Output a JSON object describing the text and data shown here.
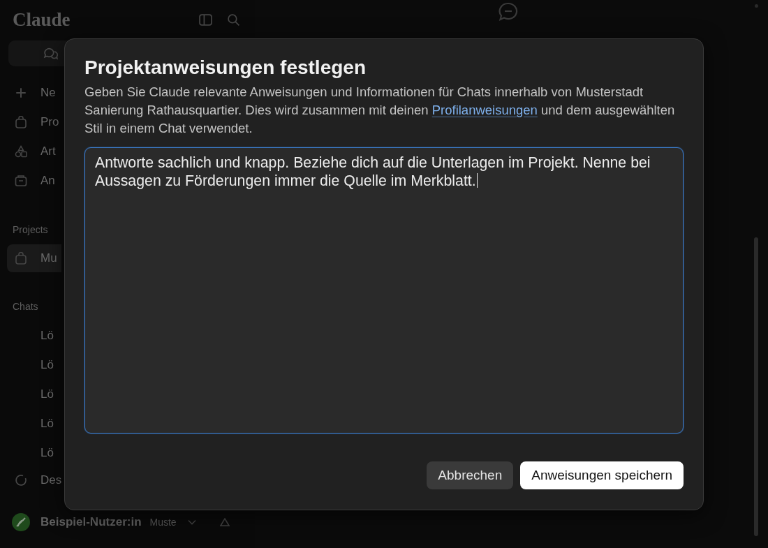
{
  "sidebar": {
    "logo": "Claude",
    "nav_items": [
      {
        "label": "Ne",
        "kind": "plus"
      },
      {
        "label": "Pro",
        "kind": "bag"
      },
      {
        "label": "Art",
        "kind": "shapes"
      },
      {
        "label": "An",
        "kind": "box"
      }
    ],
    "sections": [
      {
        "heading": "Projects",
        "kind": "projects",
        "items": [
          {
            "label": "Mu",
            "selected": true
          }
        ]
      },
      {
        "heading": "Chats",
        "kind": "chats",
        "items": [
          {
            "label": "Lö",
            "selected": false
          },
          {
            "label": "Lö",
            "selected": false
          },
          {
            "label": "Lö",
            "selected": false
          },
          {
            "label": "Lö",
            "selected": false
          },
          {
            "label": "Lö",
            "selected": false
          }
        ]
      }
    ],
    "bottom_item": {
      "label": "Des"
    },
    "user": {
      "name": "Beispiel-Nutzer:in",
      "plan": "Muste"
    }
  },
  "dialog": {
    "title": "Projektanweisungen festlegen",
    "description": {
      "before": "Geben Sie Claude relevante Anweisungen und Informationen für Chats innerhalb von Musterstadt Sanierung Rathausquartier. Dies wird zusammen mit deinen ",
      "link": "Profilanweisungen",
      "after": " und dem ausgewählten Stil in einem Chat verwendet."
    },
    "instructions": {
      "value": "Antworte sachlich und knapp. Beziehe dich auf die Unterlagen im Projekt. Nenne bei Aussagen zu Förderungen immer die Quelle im Merkblatt.",
      "focused": true
    },
    "buttons": [
      {
        "label": "Abbrechen",
        "kind": "secondary"
      },
      {
        "label": "Anweisungen speichern",
        "kind": "primary"
      }
    ]
  }
}
